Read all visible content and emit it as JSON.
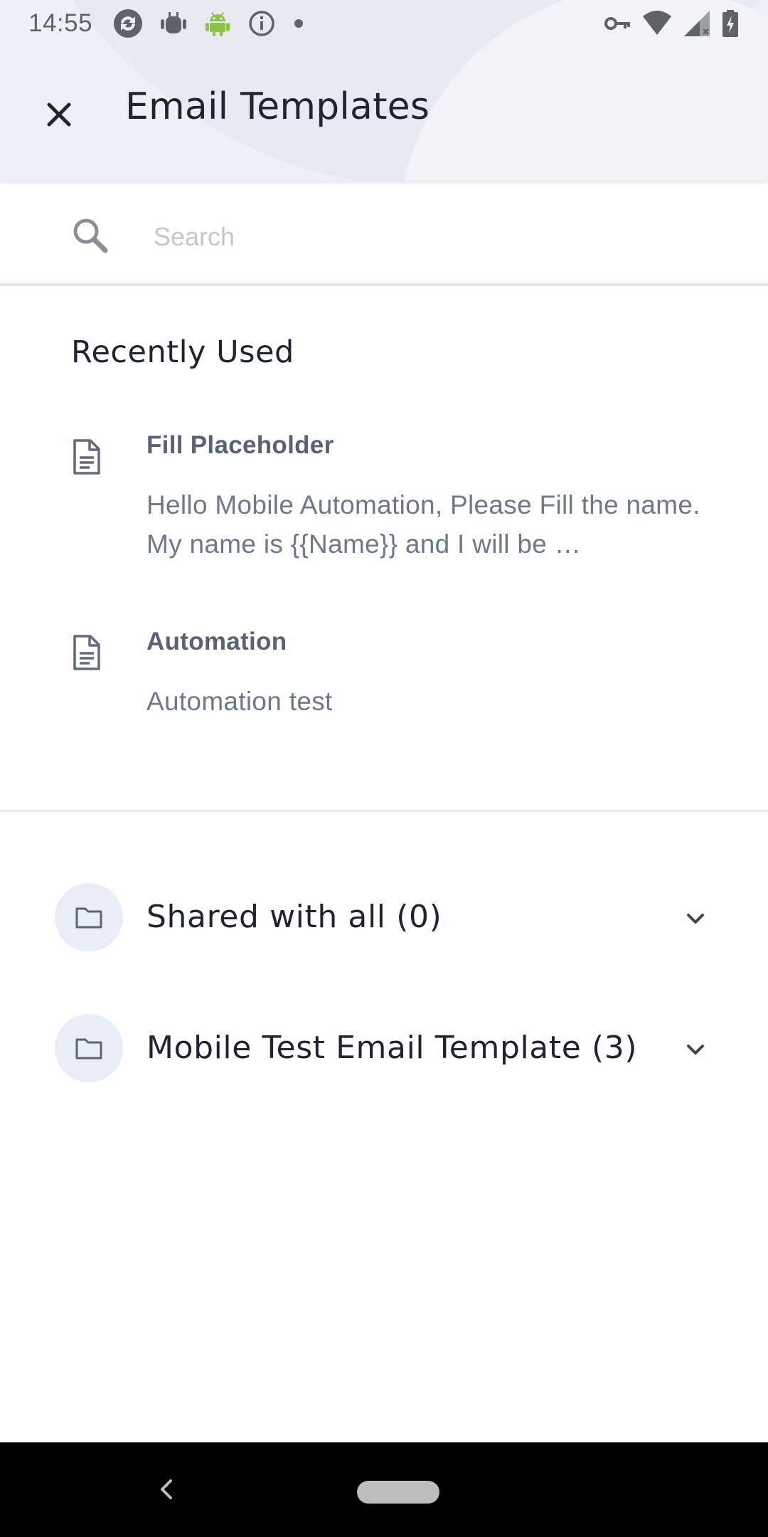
{
  "status_bar": {
    "time": "14:55",
    "left_icons": [
      "sync-icon",
      "android-debug-icon",
      "android-icon",
      "info-icon",
      "dot-icon"
    ],
    "right_icons": [
      "vpn-key-icon",
      "wifi-icon",
      "signal-icon",
      "battery-charging-icon"
    ]
  },
  "app_bar": {
    "title": "Email Templates",
    "close_icon": "close-icon"
  },
  "search": {
    "placeholder": "Search",
    "value": ""
  },
  "recently_used": {
    "title": "Recently Used",
    "items": [
      {
        "name": "Fill Placeholder",
        "body": "Hello Mobile Automation, Please Fill the name. My name is {{Name}} and I will be …"
      },
      {
        "name": "Automation",
        "body": "Automation test"
      }
    ]
  },
  "folders": [
    {
      "label": "Shared with all (0)"
    },
    {
      "label": "Mobile Test Email Template (3)"
    }
  ],
  "colors": {
    "header_bg": "#edf0f7",
    "folder_badge_bg": "#e9edf8",
    "android_green": "#8bc34a",
    "text_dark": "#1f2430",
    "text_muted": "#6d7888"
  }
}
